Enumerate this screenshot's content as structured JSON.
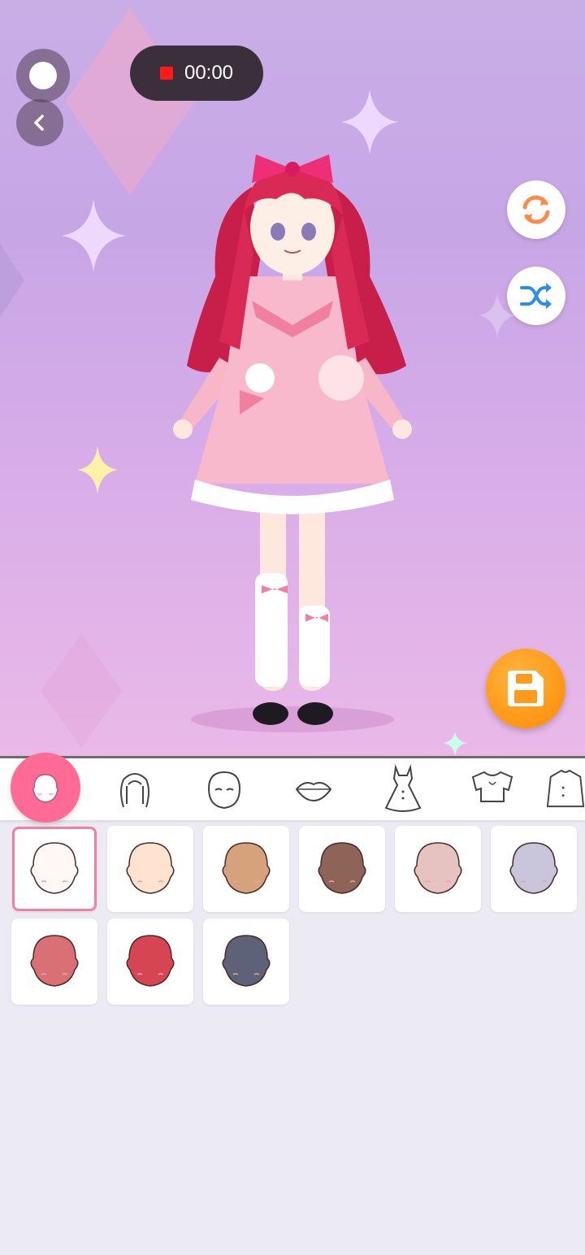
{
  "recording": {
    "time": "00:00",
    "dot_color": "#ff1a1a"
  },
  "icons": {
    "home": "circle-home-icon",
    "back": "chevron-left-icon",
    "reset": "refresh-icon",
    "shuffle": "shuffle-icon",
    "save": "floppy-disk-icon"
  },
  "tabs": [
    {
      "name": "face-tab",
      "icon": "face-icon",
      "active": true
    },
    {
      "name": "hair-tab",
      "icon": "hair-icon",
      "active": false
    },
    {
      "name": "eyes-tab",
      "icon": "head-eyes-icon",
      "active": false
    },
    {
      "name": "lips-tab",
      "icon": "lips-icon",
      "active": false
    },
    {
      "name": "dress-tab",
      "icon": "dress-icon",
      "active": false
    },
    {
      "name": "top-tab",
      "icon": "crop-top-icon",
      "active": false
    },
    {
      "name": "coat-tab",
      "icon": "coat-icon",
      "active": false
    }
  ],
  "skin_tones": [
    {
      "color": "#fff8f4",
      "selected": true
    },
    {
      "color": "#ffe3d0",
      "selected": false
    },
    {
      "color": "#d6a27c",
      "selected": false
    },
    {
      "color": "#8f6458",
      "selected": false
    },
    {
      "color": "#e6c3c1",
      "selected": false
    },
    {
      "color": "#c9c6dc",
      "selected": false
    },
    {
      "color": "#d87076",
      "selected": false
    },
    {
      "color": "#d64552",
      "selected": false
    },
    {
      "color": "#5d6279",
      "selected": false
    }
  ],
  "colors": {
    "accent": "#ff6b95",
    "save": "#ff8a00"
  }
}
